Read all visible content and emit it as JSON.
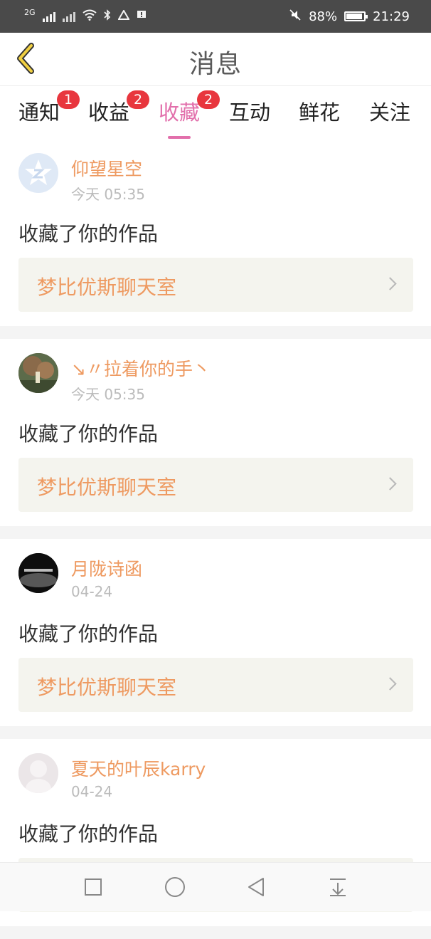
{
  "status_bar": {
    "network": "2G",
    "battery": "88%",
    "time": "21:29"
  },
  "header": {
    "back_icon": "chevron-left-icon",
    "title": "消息"
  },
  "tabs": [
    {
      "label": "通知",
      "badge": "1",
      "active": false
    },
    {
      "label": "收益",
      "badge": "2",
      "active": false
    },
    {
      "label": "收藏",
      "badge": "2",
      "active": true
    },
    {
      "label": "互动",
      "badge": "",
      "active": false
    },
    {
      "label": "鲜花",
      "badge": "",
      "active": false
    },
    {
      "label": "关注",
      "badge": "",
      "active": false
    }
  ],
  "feed": {
    "items": [
      {
        "user": "仰望星空",
        "time": "今天 05:35",
        "action": "收藏了你的作品",
        "work": "梦比优斯聊天室"
      },
      {
        "user": "↘〃拉着你的手丶",
        "time": "今天 05:35",
        "action": "收藏了你的作品",
        "work": "梦比优斯聊天室"
      },
      {
        "user": "月陇诗函",
        "time": "04-24",
        "action": "收藏了你的作品",
        "work": "梦比优斯聊天室"
      },
      {
        "user": "夏天的叶辰karry",
        "time": "04-24",
        "action": "收藏了你的作品",
        "work": ""
      }
    ]
  },
  "nav_bar": {
    "buttons": [
      "square-recents-icon",
      "circle-home-icon",
      "triangle-back-icon",
      "notification-pull-icon"
    ]
  },
  "colors": {
    "accent": "#e26fab",
    "username": "#ee9a61",
    "badge": "#e8363e"
  }
}
